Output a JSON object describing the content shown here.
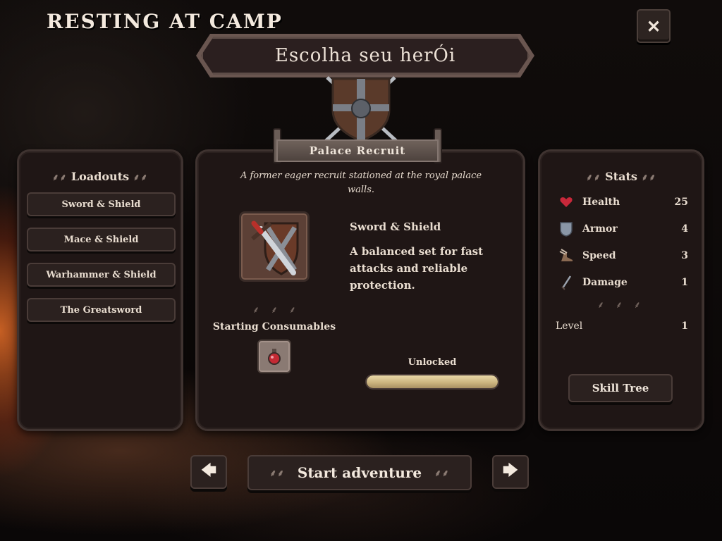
{
  "screen": {
    "title": "RESTING AT CAMP",
    "close_symbol": "✕",
    "banner_text": "Escolha seu herÓi"
  },
  "loadouts": {
    "title": "Loadouts",
    "items": [
      {
        "label": "Sword & Shield"
      },
      {
        "label": "Mace & Shield"
      },
      {
        "label": "Warhammer & Shield"
      },
      {
        "label": "The Greatsword"
      }
    ]
  },
  "hero": {
    "name": "Palace Recruit",
    "description": "A former eager recruit stationed at the royal palace walls.",
    "weapon_name": "Sword & Shield",
    "weapon_description": "A balanced set for fast attacks and reliable protection.",
    "weapon_icon": "sword-and-shield-icon",
    "consumables_label": "Starting Consumables",
    "consumables": [
      {
        "icon": "red-potion-icon"
      }
    ],
    "unlock_label": "Unlocked",
    "unlock_progress": 1.0
  },
  "stats": {
    "title": "Stats",
    "rows": [
      {
        "name": "Health",
        "value": "25",
        "icon": "heart-icon",
        "color": "#c8283a"
      },
      {
        "name": "Armor",
        "value": "4",
        "icon": "armor-icon",
        "color": "#8a96a6"
      },
      {
        "name": "Speed",
        "value": "3",
        "icon": "winged-boot-icon",
        "color": "#8a6a52"
      },
      {
        "name": "Damage",
        "value": "1",
        "icon": "dagger-icon",
        "color": "#9aa2ad"
      }
    ],
    "level_label": "Level",
    "level_value": "1",
    "skill_tree_label": "Skill Tree"
  },
  "navigation": {
    "prev_symbol": "🡄",
    "next_symbol": "🡆",
    "start_label": "Start adventure"
  }
}
